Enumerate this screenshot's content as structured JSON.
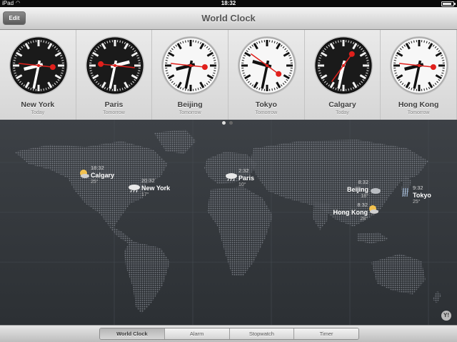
{
  "status_bar": {
    "carrier": "iPad",
    "time": "18:32",
    "battery_level": 0.85
  },
  "nav": {
    "edit_label": "Edit",
    "title": "World Clock"
  },
  "clocks": [
    {
      "city": "New York",
      "day": "Today",
      "hour": 20,
      "minute": 32,
      "face": "dark"
    },
    {
      "city": "Paris",
      "day": "Tomorrow",
      "hour": 2,
      "minute": 32,
      "face": "dark"
    },
    {
      "city": "Beijing",
      "day": "Tomorrow",
      "hour": 8,
      "minute": 32,
      "face": "light"
    },
    {
      "city": "Tokyo",
      "day": "Tomorrow",
      "hour": 9,
      "minute": 32,
      "face": "light"
    },
    {
      "city": "Calgary",
      "day": "Today",
      "hour": 18,
      "minute": 32,
      "face": "dark"
    },
    {
      "city": "Hong Kong",
      "day": "Tomorrow",
      "hour": 8,
      "minute": 32,
      "face": "light"
    }
  ],
  "map_pins": {
    "calgary": {
      "time": "18:32",
      "city": "Calgary",
      "temp": "25°",
      "weather": "sun-cloud-icon"
    },
    "newyork": {
      "time": "20:32",
      "city": "New York",
      "temp": "17°",
      "weather": "rain-icon"
    },
    "paris": {
      "time": "2:32",
      "city": "Paris",
      "temp": "10°",
      "weather": "rain-icon"
    },
    "beijing": {
      "time": "8:32",
      "city": "Beijing",
      "temp": "18°",
      "weather": "cloud-icon"
    },
    "hongkong": {
      "time": "8:32",
      "city": "Hong Kong",
      "temp": "28°",
      "weather": "sun-cloud-icon"
    },
    "tokyo": {
      "time": "9:32",
      "city": "Tokyo",
      "temp": "25°",
      "weather": "rain-icon"
    }
  },
  "pager": {
    "pages": 2,
    "current": 1
  },
  "yahoo_logo": "Y!",
  "tabs": [
    {
      "label": "World Clock",
      "active": true
    },
    {
      "label": "Alarm",
      "active": false
    },
    {
      "label": "Stopwatch",
      "active": false
    },
    {
      "label": "Timer",
      "active": false
    }
  ],
  "colors": {
    "second_hand": "#e0201c",
    "dark_face": "#1a1a1a",
    "light_face": "#f7f7f7"
  }
}
